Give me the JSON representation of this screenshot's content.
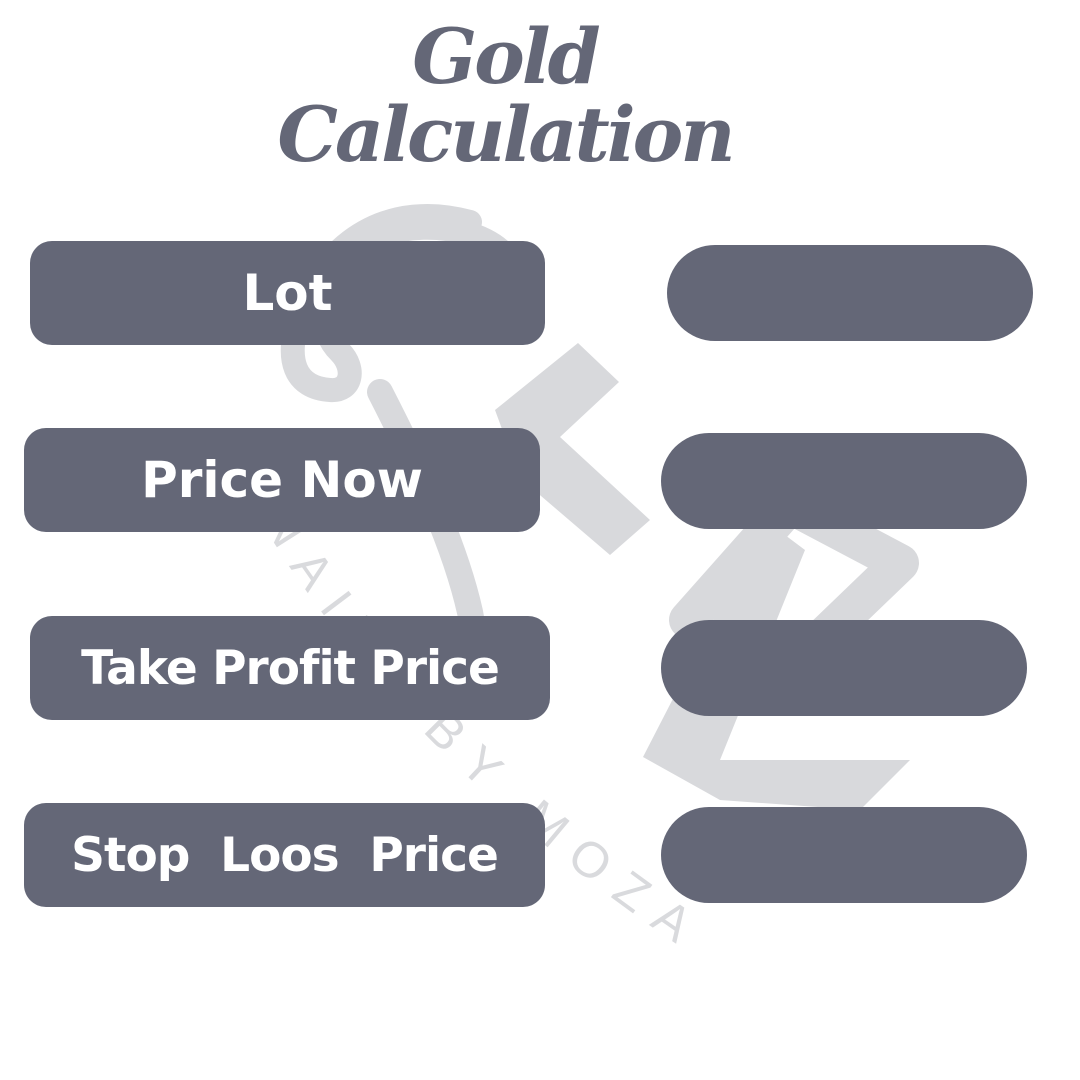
{
  "title": {
    "line1": "Gold",
    "line2": "Calculation"
  },
  "fields": [
    {
      "label": "Lot",
      "value": ""
    },
    {
      "label": "Price Now",
      "value": ""
    },
    {
      "label": "Take Profit Price",
      "value": ""
    },
    {
      "label": "Stop  Loos  Price",
      "value": ""
    }
  ],
  "watermark": {
    "text": "NAILS BY MOZA"
  },
  "colors": {
    "primary": "#646777",
    "watermark": "#d8d9dc",
    "background": "#ffffff",
    "label_text": "#ffffff"
  }
}
